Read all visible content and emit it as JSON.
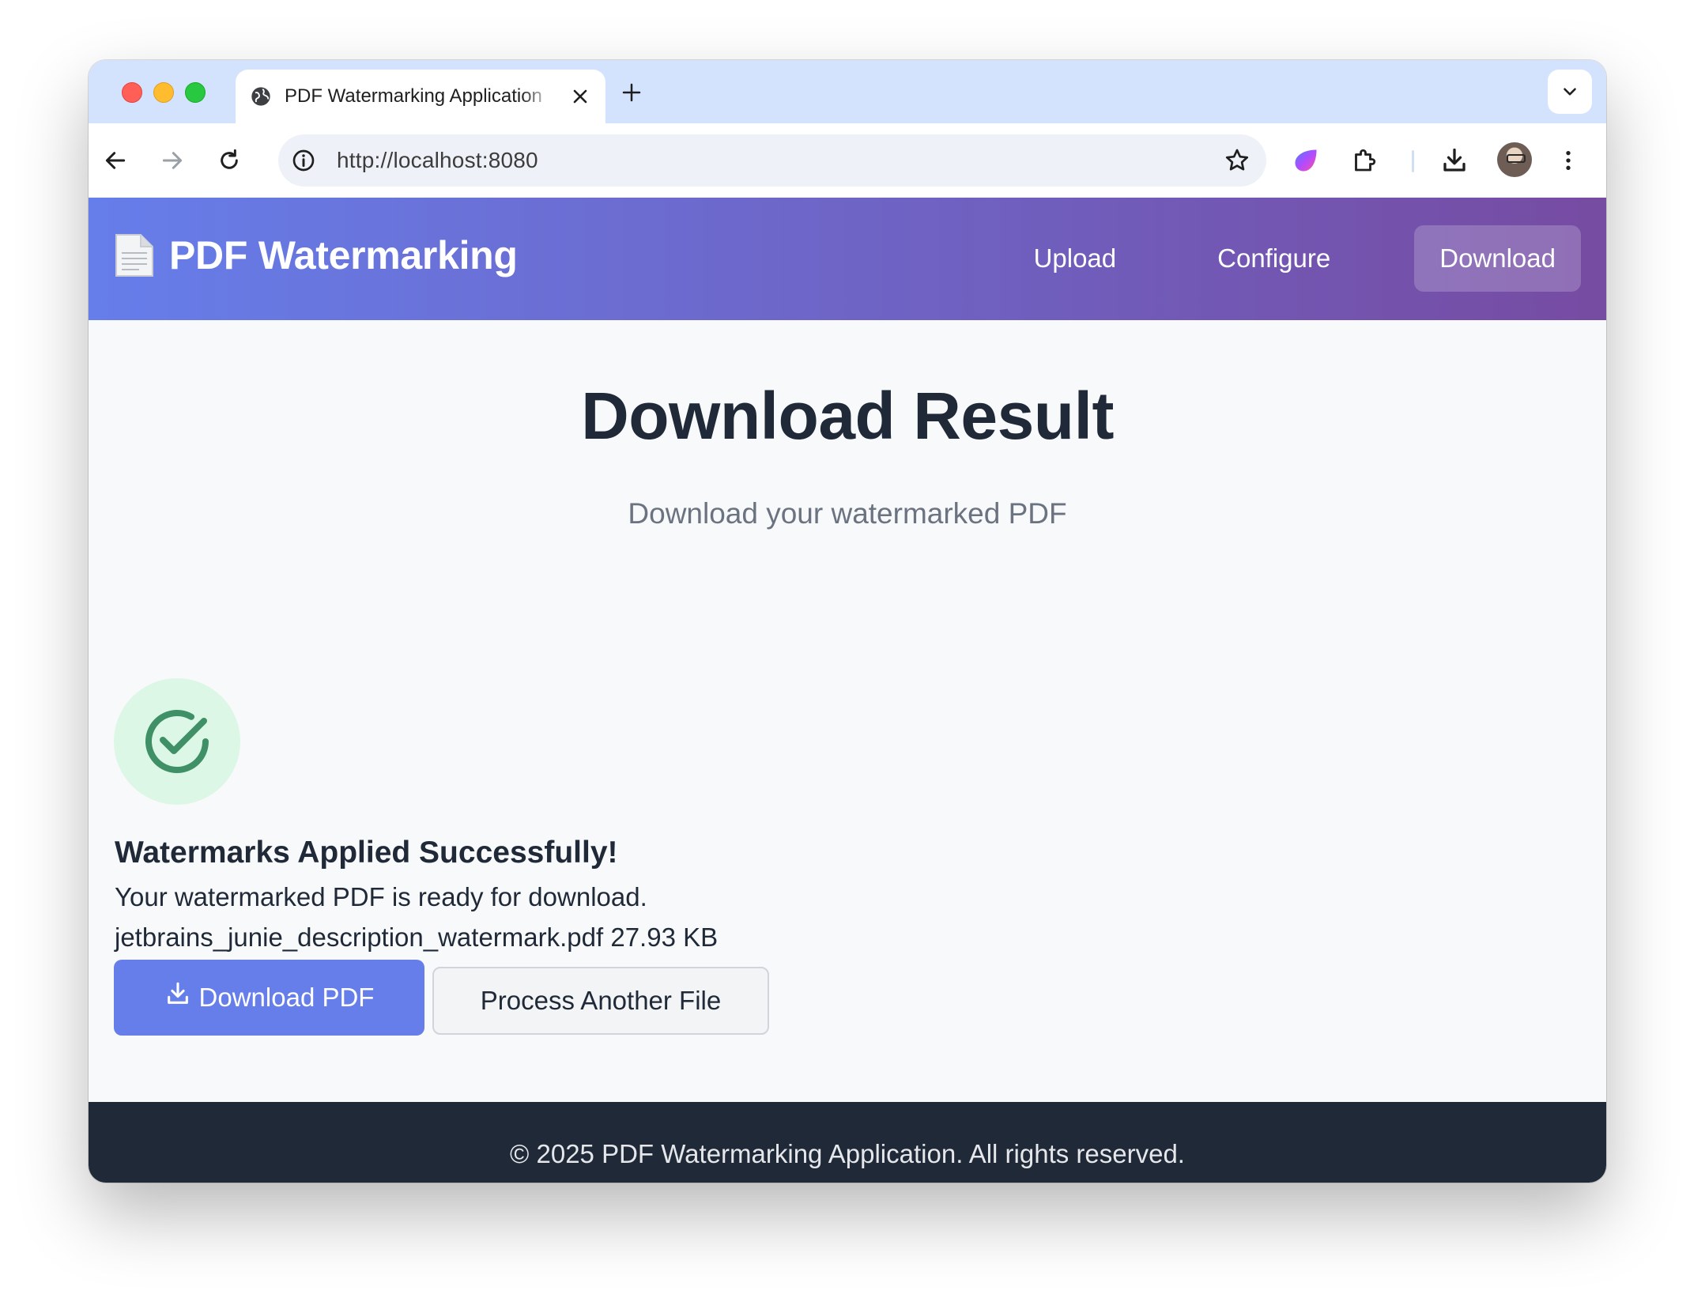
{
  "browser": {
    "tab_title": "PDF Watermarking Application",
    "url": "http://localhost:8080"
  },
  "app": {
    "brand_name": "PDF Watermarking",
    "brand_icon": "page-facing-up-icon",
    "nav": [
      "Upload",
      "Configure",
      "Download"
    ],
    "active_nav": "Download"
  },
  "main": {
    "title": "Download Result",
    "subtitle": "Download your watermarked PDF",
    "success_title": "Watermarks Applied Successfully!",
    "success_message": "Your watermarked PDF is ready for download.",
    "file_name": "jetbrains_junie_description_watermark.pdf",
    "file_size": "27.93 KB",
    "download_button": "Download PDF",
    "process_another_button": "Process Another File"
  },
  "footer": {
    "text": "© 2025 PDF Watermarking Application. All rights reserved."
  },
  "colors": {
    "header_gradient_start": "#667eea",
    "header_gradient_end": "#764ba2",
    "primary_button": "#667eea",
    "success_green": "#3f8f67",
    "footer_bg": "#1f2937"
  }
}
